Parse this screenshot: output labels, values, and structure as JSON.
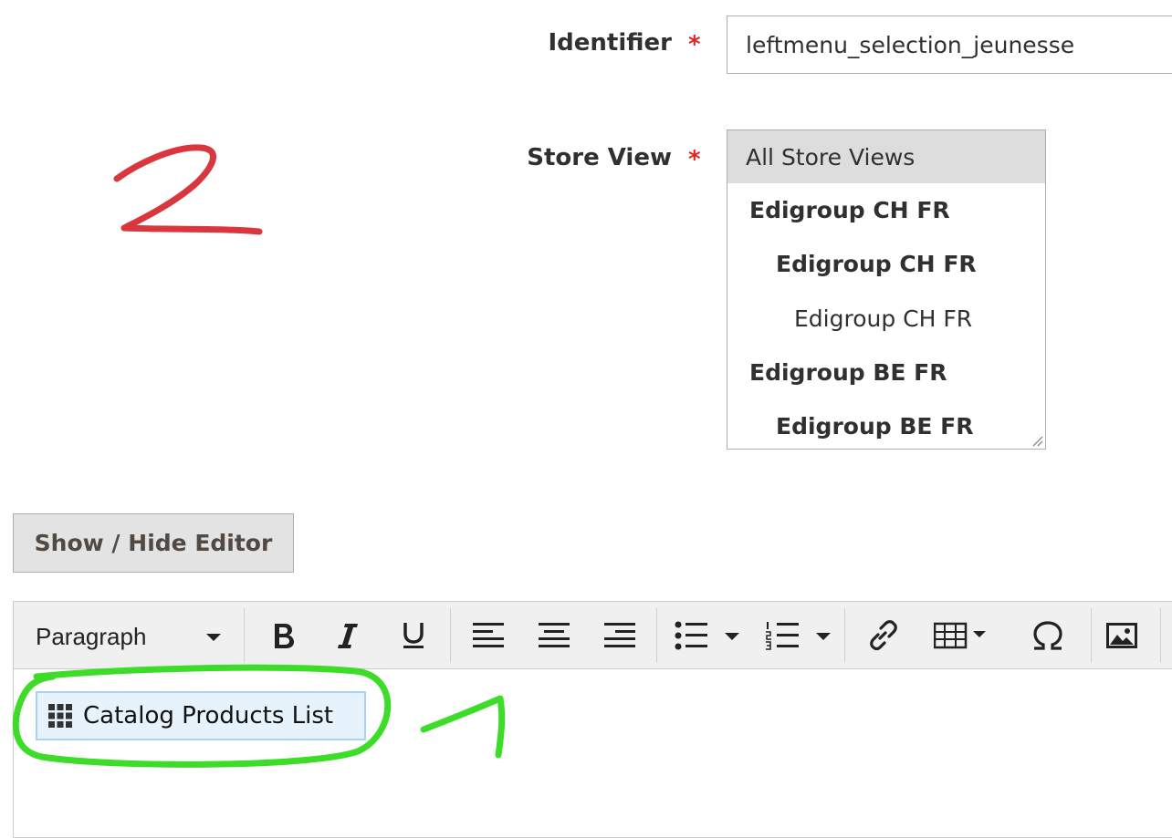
{
  "identifier": {
    "label": "Identifier",
    "required_mark": "*",
    "value": "leftmenu_selection_jeunesse"
  },
  "store_view": {
    "label": "Store View",
    "required_mark": "*",
    "options": [
      {
        "label": "All Store Views",
        "selected": true
      },
      {
        "label": "Edigroup CH FR",
        "bold": true
      },
      {
        "label": "Edigroup CH FR",
        "bold": true
      },
      {
        "label": "Edigroup CH FR"
      },
      {
        "label": "Edigroup BE FR",
        "bold": true
      },
      {
        "label": "Edigroup BE FR",
        "bold": true
      }
    ]
  },
  "show_hide_button": "Show / Hide Editor",
  "editor": {
    "format_select": "Paragraph",
    "toolbar_icons": [
      "bold-icon",
      "italic-icon",
      "underline-icon",
      "align-left-icon",
      "align-center-icon",
      "align-right-icon",
      "bullet-list-icon",
      "numbered-list-icon",
      "link-icon",
      "table-icon",
      "special-character-icon",
      "image-icon"
    ],
    "widget_label": "Catalog Products List"
  },
  "annotations": {
    "red_mark": "2",
    "red_color": "#d9363e",
    "green_color": "#3cdc28"
  },
  "colors": {
    "required": "#e22626",
    "selected_option_bg": "#dddddd",
    "widget_bg": "#e6f3fc"
  }
}
